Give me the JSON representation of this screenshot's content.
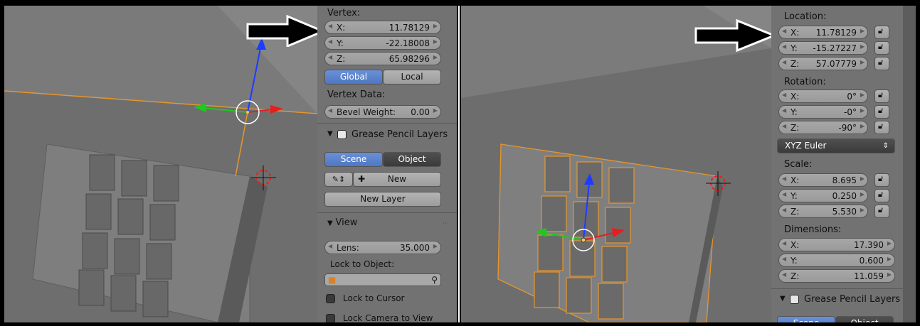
{
  "left_panel": {
    "vertex_header": "Vertex:",
    "vertex_fields": [
      {
        "label": "X:",
        "value": "11.78129"
      },
      {
        "label": "Y:",
        "value": "-22.18008"
      },
      {
        "label": "Z:",
        "value": "65.98296"
      }
    ],
    "space_buttons": [
      {
        "label": "Global",
        "selected": true
      },
      {
        "label": "Local",
        "selected": false
      }
    ],
    "vertex_data_header": "Vertex Data:",
    "bevel_weight": {
      "label": "Bevel Weight:",
      "value": "0.00"
    },
    "grease_header": "Grease Pencil Layers",
    "grease_tabs": [
      {
        "label": "Scene",
        "selected": true
      },
      {
        "label": "Object",
        "selected": false
      }
    ],
    "new_label": "New",
    "new_layer_label": "New Layer",
    "view_header": "View",
    "lens": {
      "label": "Lens:",
      "value": "35.000"
    },
    "lock_to_object_label": "Lock to Object:",
    "lock_to_cursor_label": "Lock to Cursor",
    "lock_camera_label": "Lock Camera to View"
  },
  "right_panel": {
    "location_header": "Location:",
    "location_fields": [
      {
        "label": "X:",
        "value": "11.78129"
      },
      {
        "label": "Y:",
        "value": "-15.27227"
      },
      {
        "label": "Z:",
        "value": "57.07779"
      }
    ],
    "rotation_header": "Rotation:",
    "rotation_fields": [
      {
        "label": "X:",
        "value": "0°"
      },
      {
        "label": "Y:",
        "value": "-0°"
      },
      {
        "label": "Z:",
        "value": "-90°"
      }
    ],
    "rotation_mode": "XYZ Euler",
    "scale_header": "Scale:",
    "scale_fields": [
      {
        "label": "X:",
        "value": "8.695"
      },
      {
        "label": "Y:",
        "value": "0.250"
      },
      {
        "label": "Z:",
        "value": "5.530"
      }
    ],
    "dimensions_header": "Dimensions:",
    "dimension_fields": [
      {
        "label": "X:",
        "value": "17.390"
      },
      {
        "label": "Y:",
        "value": "0.600"
      },
      {
        "label": "Z:",
        "value": "11.059"
      }
    ],
    "grease_header": "Grease Pencil Layers",
    "grease_tabs": [
      {
        "label": "Scene",
        "selected": true
      },
      {
        "label": "Object",
        "selected": false
      }
    ]
  },
  "colors": {
    "selection_orange": "#e6962d",
    "axis_red": "#e61e1e",
    "axis_green": "#1ec81e",
    "axis_blue": "#1e3cff",
    "button_selected": "#5a84cf"
  },
  "icons": [
    "arrow-annotation-icon",
    "lock-icon",
    "cube-icon",
    "eyedropper-icon",
    "pencil-icon",
    "plus-icon",
    "3d-cursor-icon",
    "transform-manipulator-icon",
    "checkbox-icon",
    "drag-handle-icon"
  ]
}
